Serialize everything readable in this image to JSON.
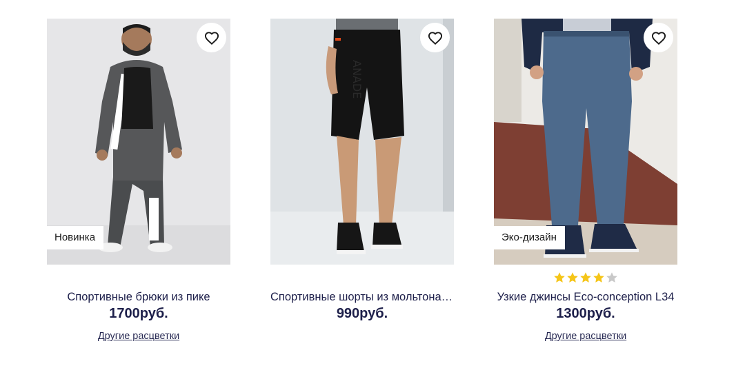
{
  "products": [
    {
      "title": "Спортивные брюки из пике",
      "price": "1700руб.",
      "badge": "Новинка",
      "other_colors": "Другие расцветки"
    },
    {
      "title": "Спортивные шорты из мольтона с принтом",
      "price": "990руб.",
      "badge": "",
      "other_colors": ""
    },
    {
      "title": "Узкие джинсы Eco-conception L34",
      "price": "1300руб.",
      "badge": "Эко-дизайн",
      "other_colors": "Другие расцветки",
      "rating": 4,
      "rating_max": 5
    }
  ],
  "icons": {
    "favorite": "heart-outline-icon",
    "star": "star-icon"
  },
  "colors": {
    "text_dark": "#1d1f4a",
    "star_filled": "#f5c518",
    "star_empty": "#c8c8c8"
  }
}
